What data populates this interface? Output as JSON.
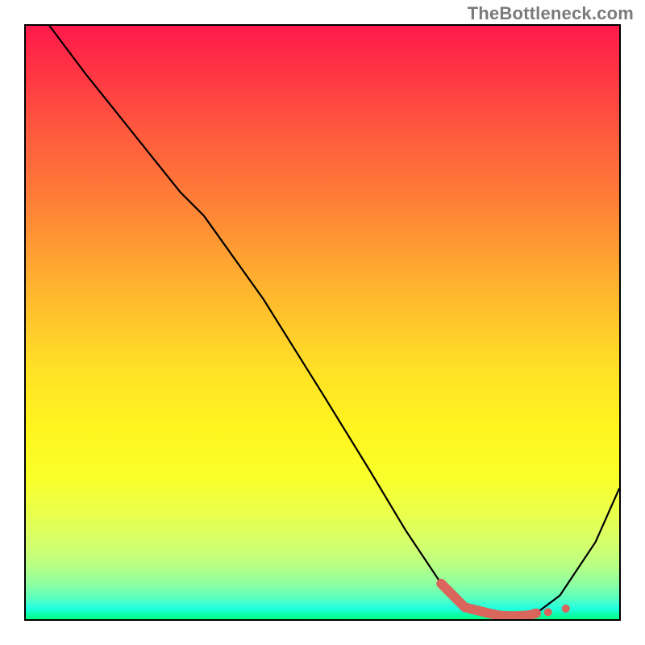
{
  "watermark": "TheBottleneck.com",
  "chart_data": {
    "type": "line",
    "title": "",
    "xlabel": "",
    "ylabel": "",
    "xlim": [
      0,
      100
    ],
    "ylim": [
      0,
      100
    ],
    "series": [
      {
        "name": "main-curve",
        "x": [
          4,
          10,
          18,
          26,
          30,
          40,
          50,
          58,
          64,
          70,
          74,
          78,
          82,
          86,
          90,
          96,
          100
        ],
        "y": [
          100,
          92,
          82,
          72,
          68,
          54,
          38,
          25,
          15,
          6,
          2,
          1,
          0.5,
          1,
          4,
          13,
          22
        ]
      },
      {
        "name": "highlight-segment",
        "x": [
          70,
          74,
          78,
          80,
          82,
          84,
          85,
          86
        ],
        "y": [
          6,
          2,
          1,
          0.6,
          0.5,
          0.6,
          0.7,
          1
        ]
      }
    ],
    "gradient_stops": [
      {
        "pos": 0,
        "color": "#ff1a4b"
      },
      {
        "pos": 50,
        "color": "#ffd928"
      },
      {
        "pos": 80,
        "color": "#f6ff30"
      },
      {
        "pos": 100,
        "color": "#00ff7f"
      }
    ]
  }
}
